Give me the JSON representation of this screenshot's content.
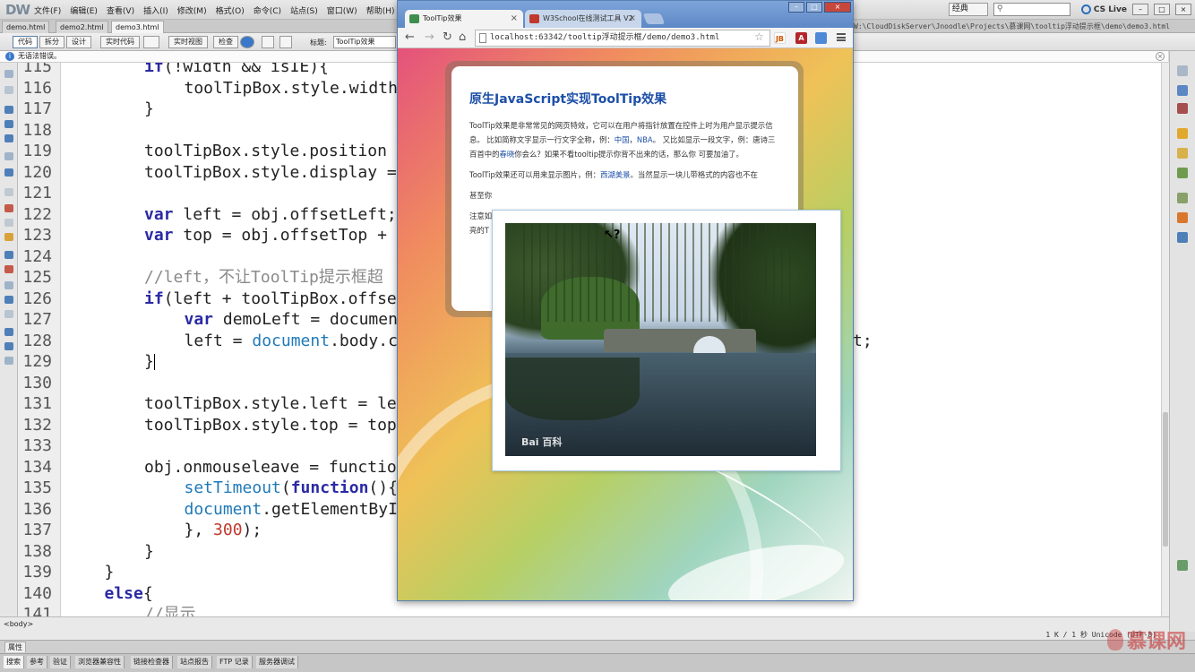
{
  "dw": {
    "logo": "DW",
    "menu": [
      "文件(F)",
      "编辑(E)",
      "查看(V)",
      "插入(I)",
      "修改(M)",
      "格式(O)",
      "命令(C)",
      "站点(S)",
      "窗口(W)",
      "帮助(H)"
    ],
    "workspace": "经典",
    "cslive": "CS Live",
    "doc_tabs": [
      "demo.html",
      "demo2.html",
      "demo3.html"
    ],
    "file_path": "W:\\CloudDiskServer\\Jnoodle\\Projects\\慕课网\\tooltip浮动提示框\\demo\\demo3.html",
    "toolbar": {
      "code": "代码",
      "split": "拆分",
      "design": "设计",
      "live_code": "实时代码",
      "live_view": "实时视图",
      "inspect": "检查",
      "title_label": "标题:",
      "title_value": "ToolTip效果"
    },
    "info_message": "无语法错误。",
    "tag_selector": "<body>",
    "status_info": "1 K / 1 秒  Unicode (UTF-8)",
    "properties_tab": "属性",
    "panel_tabs": [
      "搜索",
      "参考",
      "验证",
      "浏览器兼容性",
      "链接检查器",
      "站点报告",
      "FTP 记录",
      "服务器调试"
    ],
    "watermark": "慕课网"
  },
  "code_lines": [
    {
      "n": "115",
      "text": "if(!width && isIE){"
    },
    {
      "n": "116",
      "text": "toolTipBox.style.width"
    },
    {
      "n": "117",
      "text": "}"
    },
    {
      "n": "118",
      "text": ""
    },
    {
      "n": "119",
      "text": "toolTipBox.style.position"
    },
    {
      "n": "120",
      "text": "toolTipBox.style.display ="
    },
    {
      "n": "121",
      "text": ""
    },
    {
      "n": "122",
      "text": "var left = obj.offsetLeft;"
    },
    {
      "n": "123",
      "text": "var top = obj.offsetTop +"
    },
    {
      "n": "124",
      "text": ""
    },
    {
      "n": "125",
      "text": "//left，不让ToolTip提示框超"
    },
    {
      "n": "126",
      "text": "if(left + toolTipBox.offse"
    },
    {
      "n": "127",
      "text": "var demoLeft = documen"
    },
    {
      "n": "128",
      "text": "left = document.body.c"
    },
    {
      "n": "129",
      "text": "}"
    },
    {
      "n": "130",
      "text": ""
    },
    {
      "n": "131",
      "text": "toolTipBox.style.left = le"
    },
    {
      "n": "132",
      "text": "toolTipBox.style.top = top"
    },
    {
      "n": "133",
      "text": ""
    },
    {
      "n": "134",
      "text": "obj.onmouseleave = functio"
    },
    {
      "n": "135",
      "text": "setTimeout(function(){"
    },
    {
      "n": "136",
      "text": "document.getElementByI"
    },
    {
      "n": "137",
      "text": "}, 300);"
    },
    {
      "n": "138",
      "text": "}"
    },
    {
      "n": "139",
      "text": "}"
    },
    {
      "n": "140",
      "text": "else{"
    },
    {
      "n": "141",
      "text": "//显示"
    }
  ],
  "code_overflow_tail": "t;",
  "browser": {
    "tabs": [
      "ToolTip效果",
      "W3School在线测试工具 V2"
    ],
    "url": "localhost:63342/tooltip浮动提示框/demo/demo3.html",
    "ext_labels": [
      "JB",
      "A"
    ],
    "page": {
      "heading": "原生JavaScript实现ToolTip效果",
      "p1_a": "ToolTip效果是非常常见的网页特效，它可以在用户将指针放置在控件上时为用户显示提示信息。 比如简称文字显示一行文字全称，例：",
      "p1_link1": "中国",
      "p1_sep": "，",
      "p1_link2": "NBA",
      "p1_b": "。 又比如显示一段文字，例：唐诗三百首中的",
      "p1_link3": "春晓",
      "p1_c": "你会么？如果不看tooltip提示你背不出来的话，那么你 可要加油了。",
      "p2_a": "ToolTip效果还可以用来显示图片，例：",
      "p2_link": "西湖美景",
      "p2_b": "。当然显示一块儿带格式的内容也不在",
      "p3": "甚至你",
      "p4": "注意如",
      "p5": "亮的T"
    },
    "tooltip_watermark": "Bai 百科"
  }
}
